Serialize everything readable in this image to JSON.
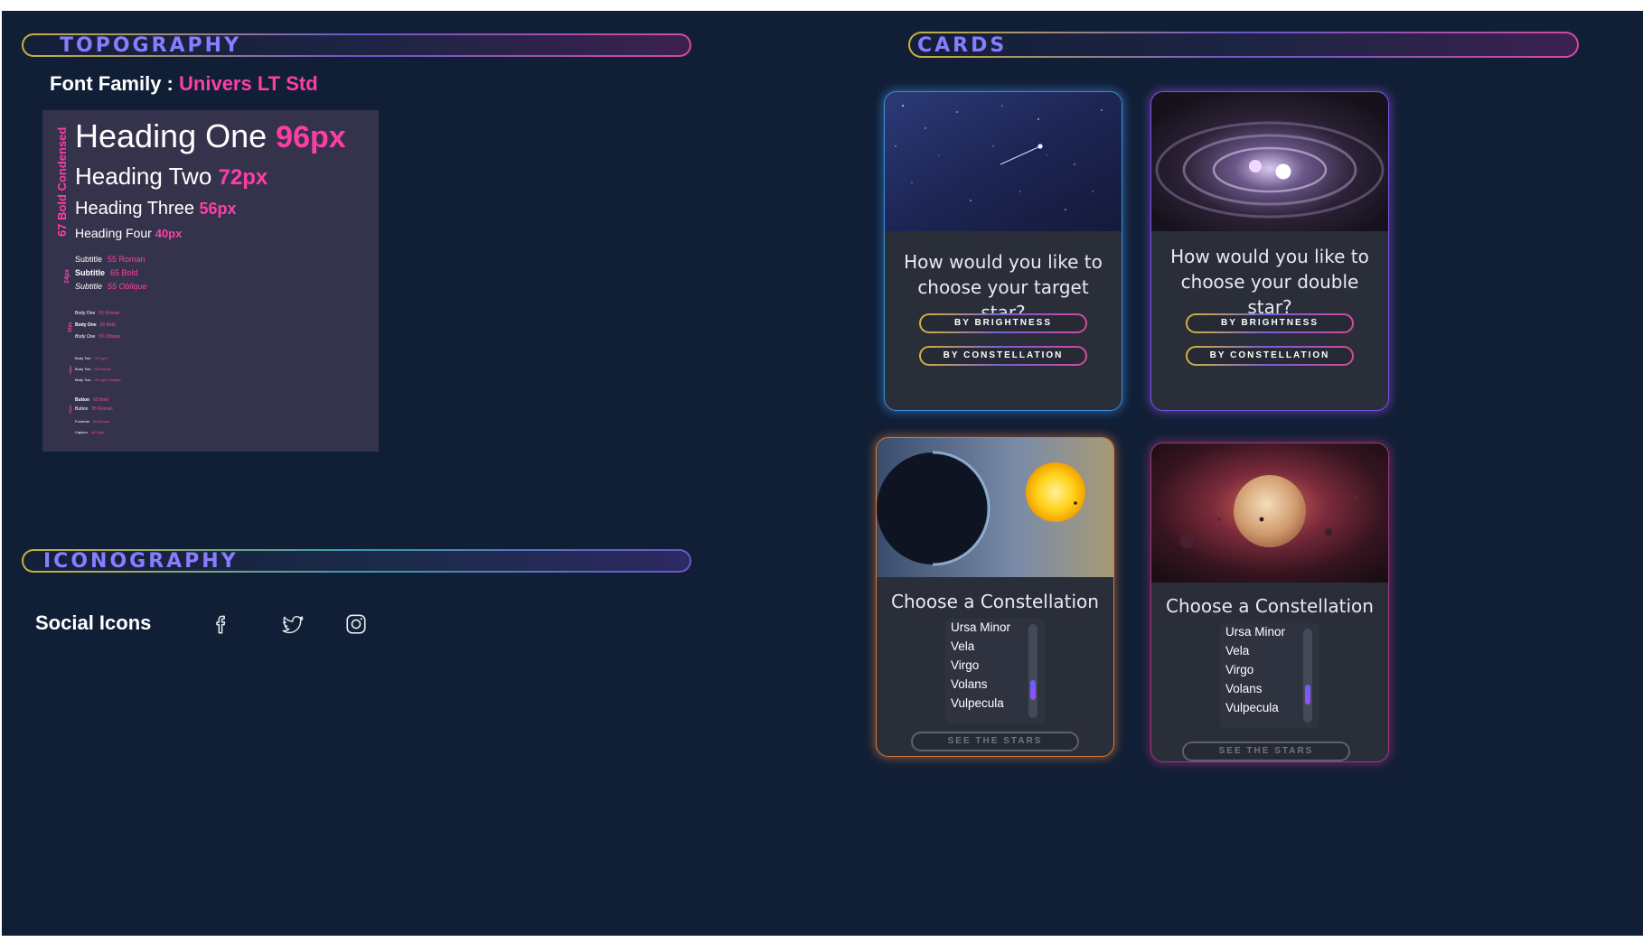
{
  "sections": {
    "typography": "TOPOGRAPHY",
    "iconography": "ICONOGRAPHY",
    "cards": "CARDS"
  },
  "typography": {
    "font_family_label": "Font Family :",
    "font_family_value": "Univers LT Std",
    "condensed_label": "67 Bold Condensed",
    "headings": [
      {
        "label": "Heading One",
        "size": "96px"
      },
      {
        "label": "Heading Two",
        "size": "72px"
      },
      {
        "label": "Heading Three",
        "size": "56px"
      },
      {
        "label": "Heading Four",
        "size": "40px"
      }
    ],
    "subtitle_size": "24px",
    "subtitles": [
      {
        "label": "Subtitle",
        "weight": "55 Roman"
      },
      {
        "label": "Subtitle",
        "weight": "65 Bold"
      },
      {
        "label": "Subtitle",
        "weight": "55 Oblique"
      }
    ],
    "body_one_size": "16px",
    "body_one": [
      {
        "label": "Body One",
        "weight": "55 Roman"
      },
      {
        "label": "Body One",
        "weight": "65 Bold"
      },
      {
        "label": "Body One",
        "weight": "55 Oblique"
      }
    ],
    "body_two_size": "14px",
    "body_two": [
      {
        "label": "Body Two",
        "weight": "45 Light"
      },
      {
        "label": "Body Two",
        "weight": "55 Roman"
      },
      {
        "label": "Body Two",
        "weight": "45 Light Oblique"
      }
    ],
    "button_size": "16px",
    "buttons": [
      {
        "label": "Button",
        "weight": "65 Bold"
      },
      {
        "label": "Button",
        "weight": "55 Roman"
      }
    ],
    "footnote": {
      "label": "Footnote",
      "weight": "55 Roman"
    },
    "caption": {
      "label": "Caption",
      "weight": "45 Light"
    }
  },
  "iconography": {
    "social_label": "Social Icons",
    "icons": [
      "facebook-icon",
      "twitter-icon",
      "instagram-icon"
    ]
  },
  "cards": {
    "card1": {
      "question": "How would you like to choose your target star?",
      "buttons": [
        "BY BRIGHTNESS",
        "BY CONSTELLATION"
      ]
    },
    "card2": {
      "question": "How would you like to choose your double star?",
      "buttons": [
        "BY BRIGHTNESS",
        "BY CONSTELLATION"
      ]
    },
    "card3": {
      "title": "Choose a Constellation",
      "options": [
        "Ursa Minor",
        "Vela",
        "Virgo",
        "Volans",
        "Vulpecula"
      ],
      "action": "SEE THE STARS"
    },
    "card4": {
      "title": "Choose a Constellation",
      "options": [
        "Ursa Minor",
        "Vela",
        "Virgo",
        "Volans",
        "Vulpecula"
      ],
      "action": "SEE THE STARS"
    }
  },
  "colors": {
    "background": "#111f36",
    "accent_pink": "#ff3ea5",
    "accent_purple": "#8a7bff",
    "panel": "#35334b",
    "card": "#2a2e38"
  }
}
